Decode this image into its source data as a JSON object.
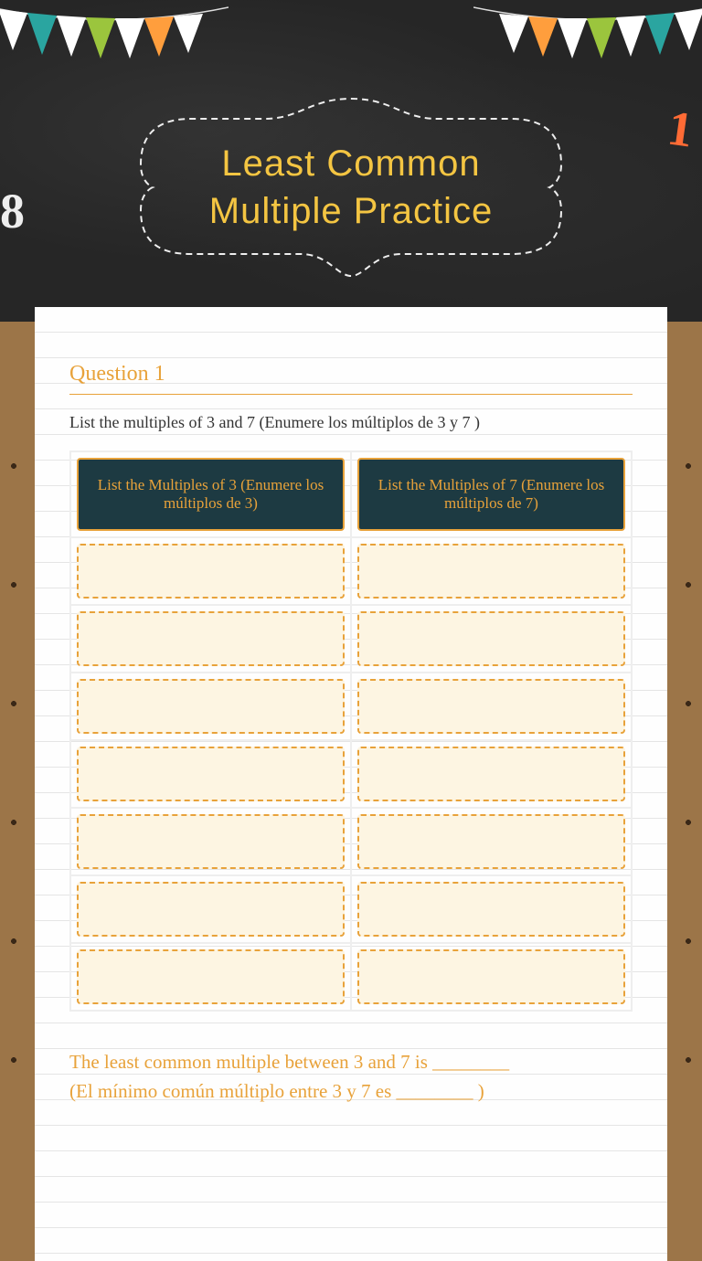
{
  "header": {
    "title": "Least Common Multiple Practice",
    "deco_left": "8",
    "deco_right": "1"
  },
  "question": {
    "label": "Question 1",
    "prompt": "List the multiples of 3 and 7 (Enumere los múltiplos de 3 y 7 )",
    "columns": [
      "List the Multiples of 3 (Enumere los múltiplos de 3)",
      "List the Multiples of 7 (Enumere los múltiplos de 7)"
    ],
    "rows": 7
  },
  "footer": {
    "line1": "The least common multiple between 3 and 7 is ________",
    "line2": "(El mínimo común múltiplo entre 3 y 7 es ________ )"
  }
}
